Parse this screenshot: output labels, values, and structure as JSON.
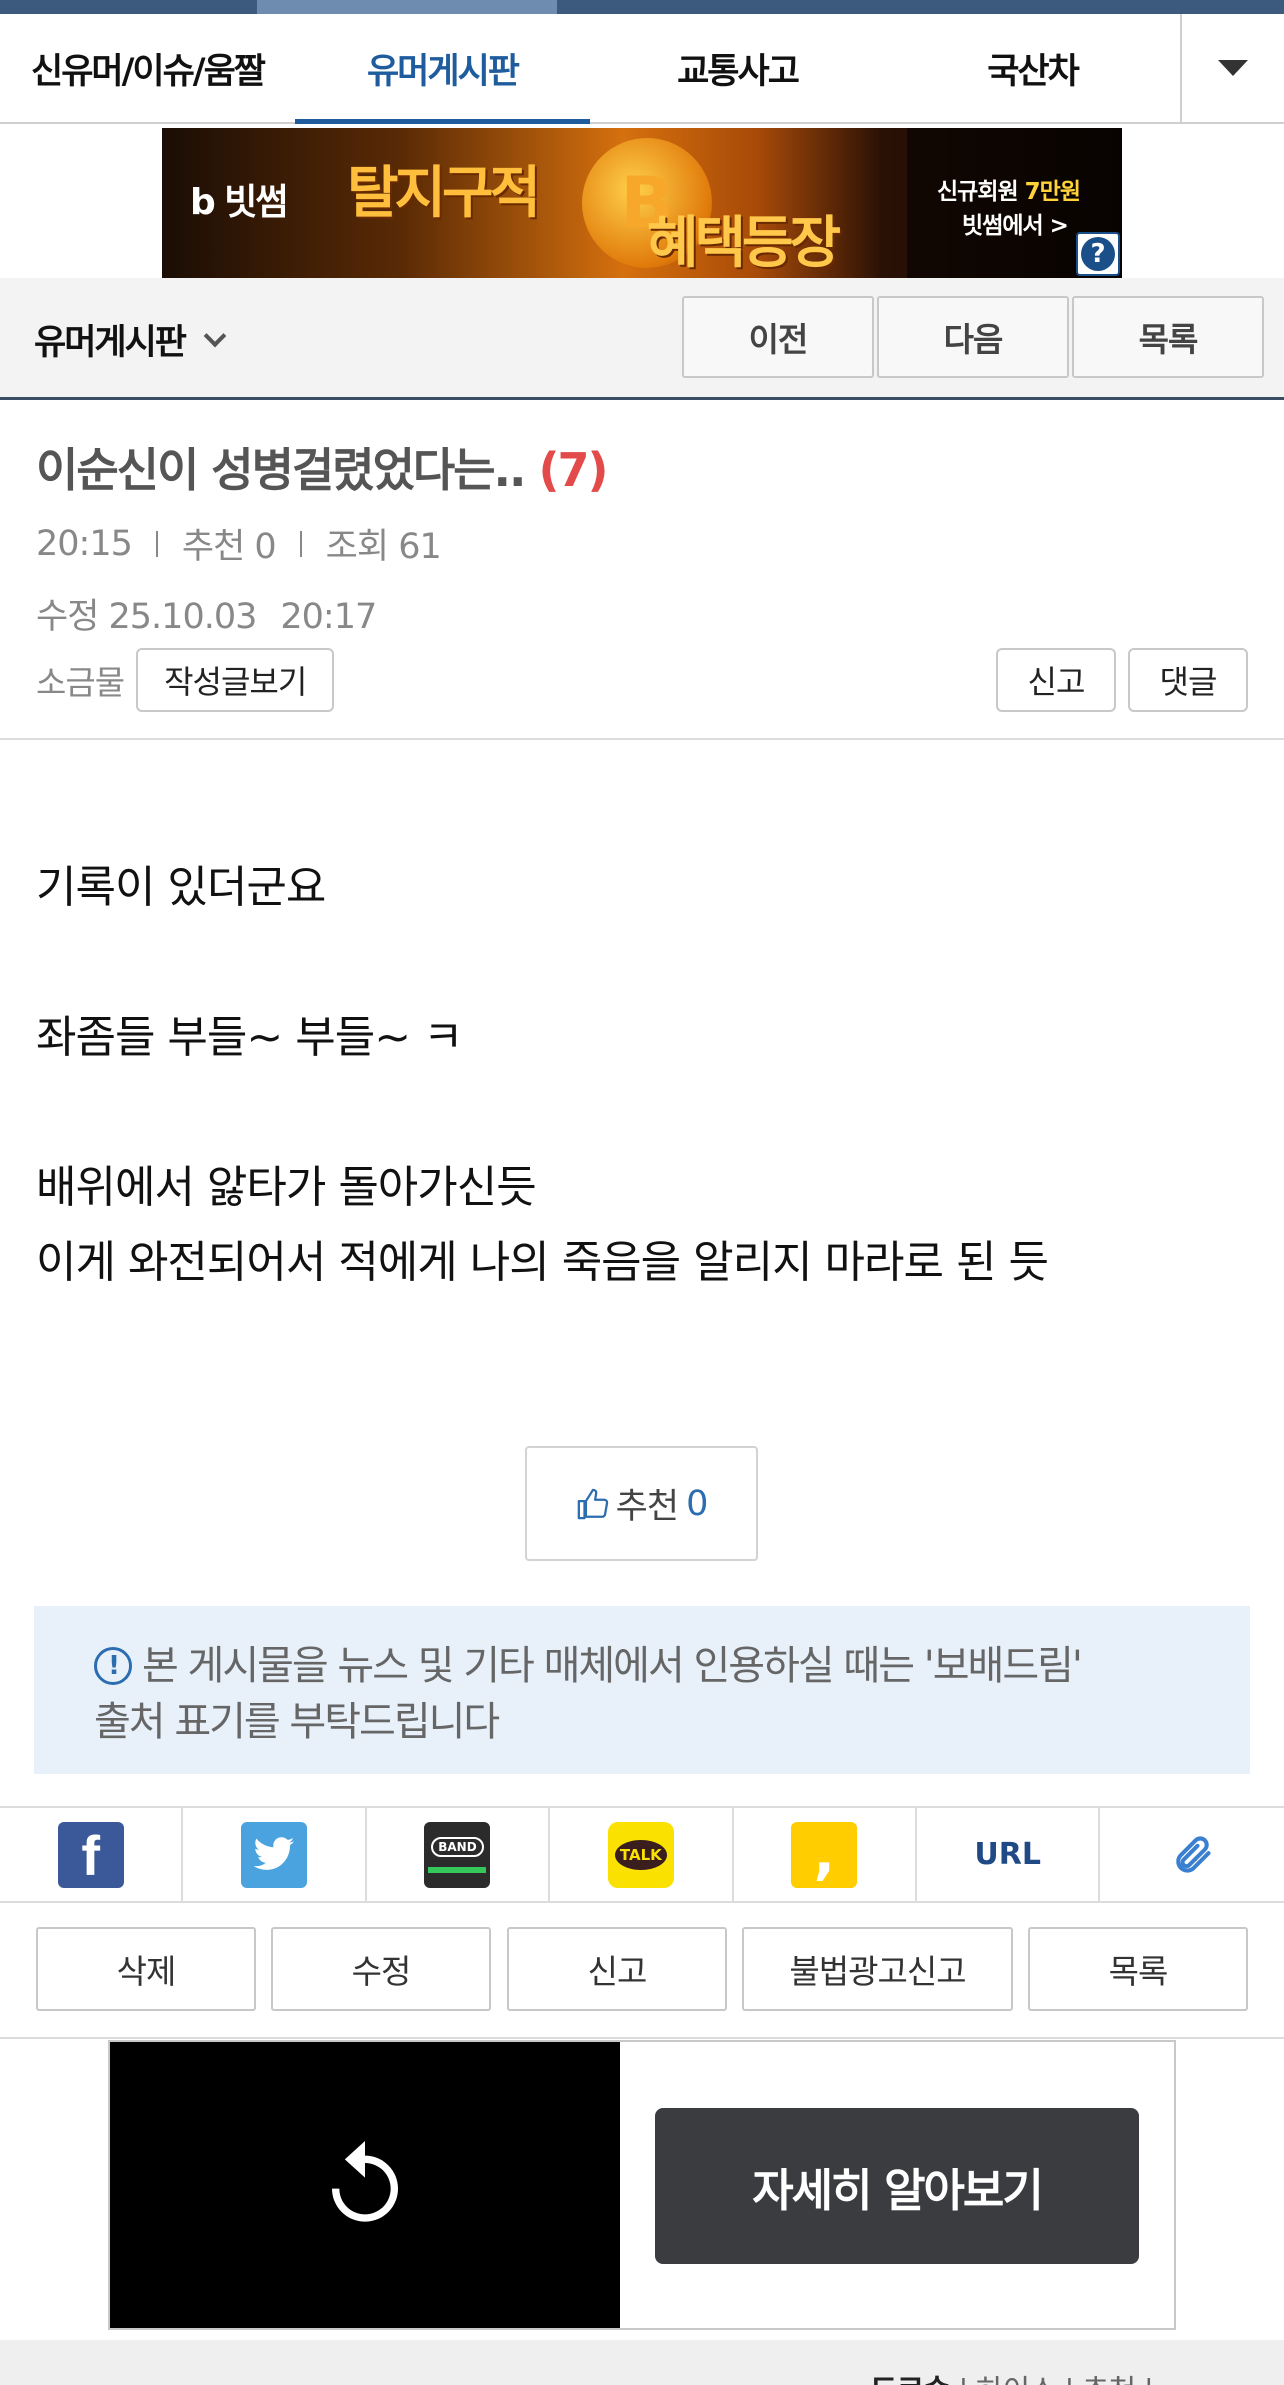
{
  "tabs": [
    {
      "label": "신유머/이슈/움짤"
    },
    {
      "label": "유머게시판",
      "active": true
    },
    {
      "label": "교통사고"
    },
    {
      "label": "국산차"
    }
  ],
  "tabs_more_icon": "chevron-down-icon",
  "banner": {
    "logo": "b 빗썸",
    "headline1": "탈지구적",
    "headline2": "혜택등장",
    "coin": "B",
    "side_line1_a": "신규회원 ",
    "side_line1_b": "7만원",
    "side_line2": "빗썸에서 >",
    "help": "?"
  },
  "board": {
    "name": "유머게시판",
    "prev_label": "이전",
    "next_label": "다음",
    "list_label": "목록"
  },
  "post": {
    "title": "이순신이 성병걸렸었다는..",
    "comment_count": "(7)",
    "time": "20:15",
    "recommend": "추천 0",
    "views": "조회 61",
    "edited_label": "수정 25.10.03",
    "edited_time": "20:17",
    "author": "소금물",
    "author_posts_label": "작성글보기",
    "report_label": "신고",
    "comment_label": "댓글",
    "body": {
      "line1": "기록이 있더군요",
      "line2": "좌좀들 부들~ 부들~ ㅋ",
      "line3": "배위에서 앓타가 돌아가신듯",
      "line4": "이게 와전되어서 적에게 나의 죽음을 알리지 마라로 된 듯"
    },
    "recommend_button": "추천",
    "recommend_count": "0"
  },
  "notice": {
    "icon": "!",
    "line1": "본 게시물을 뉴스 및 기타 매체에서 인용하실 때는 '보배드림'",
    "line2": "출처 표기를 부탁드립니다"
  },
  "share": {
    "facebook": "f",
    "band": "BAND",
    "talk": "TALK",
    "story": ",",
    "url": "URL",
    "clip": "🔗"
  },
  "actions": {
    "delete": "삭제",
    "edit": "수정",
    "report": "신고",
    "illegal_ad": "불법광고신고",
    "list": "목록"
  },
  "ad": {
    "cta": "자세히 알아보기"
  },
  "bottom": {
    "text_a": "도로숏",
    "text_b": " | 하이스 | 추천 | "
  },
  "colors": {
    "accent": "#1f5c9e",
    "header_strip": "#3b5a7e",
    "comment_count": "#e34a4a",
    "notice_bg": "#e8f1fa"
  }
}
